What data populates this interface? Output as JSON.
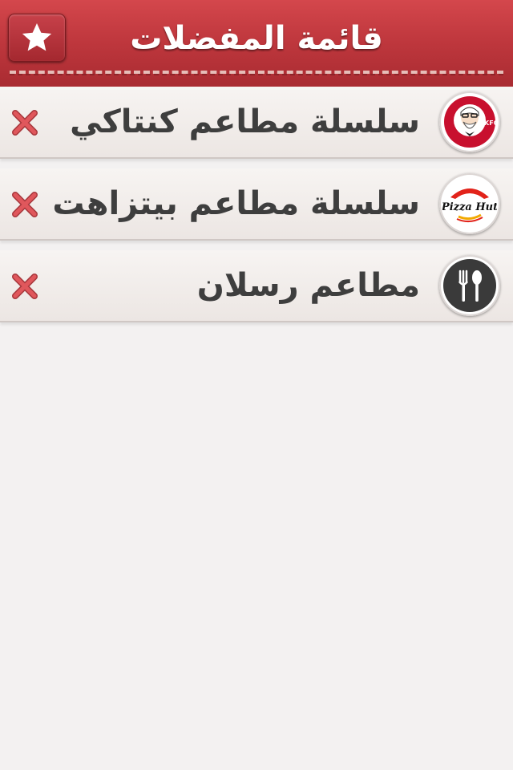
{
  "header": {
    "title": "قائمة المفضلات",
    "star_icon": "star-icon"
  },
  "favorites": [
    {
      "name": "سلسلة مطاعم كنتاكي",
      "logo": "kfc-logo-icon",
      "logo_text": "KFC"
    },
    {
      "name": "سلسلة مطاعم بيتزاهت",
      "logo": "pizza-hut-logo-icon",
      "logo_text": "Pizza Hut"
    },
    {
      "name": "مطاعم رسلان",
      "logo": "fork-spoon-icon"
    }
  ],
  "colors": {
    "header_red": "#c0383e",
    "delete_red": "#d9464c",
    "text_dark": "#3e3e3e",
    "background": "#f3f1f1"
  }
}
